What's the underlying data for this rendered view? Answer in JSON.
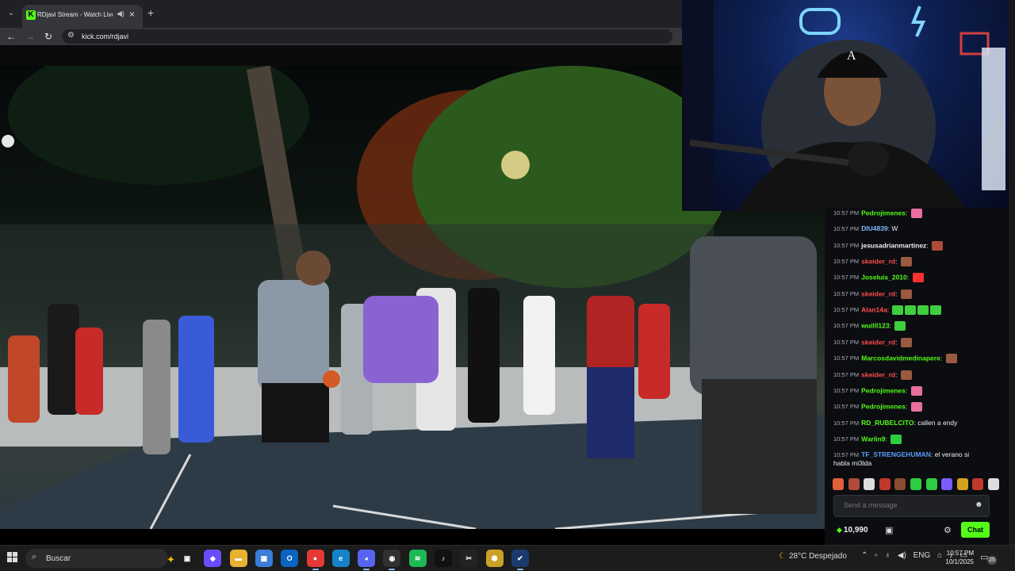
{
  "browser": {
    "tab": {
      "title": "RDjavi Stream - Watch Live",
      "favicon": "K"
    },
    "url": "kick.com/rdjavi"
  },
  "chat": {
    "messages": [
      {
        "time": "10:57 PM",
        "user": "Pedrojimenes",
        "color": "#53fc18",
        "text": "",
        "emotes": [
          "#e86fa0"
        ]
      },
      {
        "time": "10:57 PM",
        "user": "DIU4839",
        "color": "#7fb5ff",
        "text": "W",
        "emotes": []
      },
      {
        "time": "10:57 PM",
        "user": "jesusadrianmartinez",
        "color": "#efeff1",
        "text": "",
        "emotes": [
          "#b04a3a"
        ]
      },
      {
        "time": "10:57 PM",
        "user": "skeider_rd",
        "color": "#ff4d4d",
        "text": "",
        "emotes": [
          "#9a5a40"
        ]
      },
      {
        "time": "10:57 PM",
        "user": "Joseluis_2010",
        "color": "#53fc18",
        "text": "",
        "emotes": [
          "#ff3030"
        ]
      },
      {
        "time": "10:57 PM",
        "user": "skeider_rd",
        "color": "#ff4d4d",
        "text": "",
        "emotes": [
          "#9a5a40"
        ]
      },
      {
        "time": "10:57 PM",
        "user": "Alan14a",
        "color": "#ff4d4d",
        "text": "",
        "emotes": [
          "#3ecf3e",
          "#3ecf3e",
          "#3ecf3e",
          "#3ecf3e"
        ]
      },
      {
        "time": "10:57 PM",
        "user": "wuilll123",
        "color": "#53fc18",
        "text": "",
        "emotes": [
          "#3ecf3e"
        ]
      },
      {
        "time": "10:57 PM",
        "user": "skeider_rd",
        "color": "#ff4d4d",
        "text": "",
        "emotes": [
          "#9a5a40"
        ]
      },
      {
        "time": "10:57 PM",
        "user": "Marcosdavidmedinapere",
        "color": "#53fc18",
        "text": "",
        "emotes": [
          "#9a5a40"
        ]
      },
      {
        "time": "10:57 PM",
        "user": "skeider_rd",
        "color": "#ff4d4d",
        "text": "",
        "emotes": [
          "#9a5a40"
        ]
      },
      {
        "time": "10:57 PM",
        "user": "Pedrojimenes",
        "color": "#53fc18",
        "text": "",
        "emotes": [
          "#e86fa0"
        ]
      },
      {
        "time": "10:57 PM",
        "user": "Pedrojimenes",
        "color": "#53fc18",
        "text": "",
        "emotes": [
          "#e86fa0"
        ]
      },
      {
        "time": "10:57 PM",
        "user": "RD_RUBELCITO",
        "color": "#53fc18",
        "text": "callen a endy",
        "emotes": []
      },
      {
        "time": "10:57 PM",
        "user": "Warlin9",
        "color": "#53fc18",
        "text": "",
        "emotes": [
          "#2ecc40"
        ]
      },
      {
        "time": "10:57 PM",
        "user": "TF_STRENGEHUMAN",
        "color": "#5a9bff",
        "text": "el verano si",
        "text2": "habla mi3lda",
        "emotes": []
      }
    ],
    "input_placeholder": "Send a message",
    "points": "10,990",
    "send_label": "Chat",
    "emote_bar_colors": [
      "#e0603a",
      "#b04a3a",
      "#ddd",
      "#c0392b",
      "#8b4c2f",
      "#2ecc40",
      "#2ecc40",
      "#7a5cff",
      "#d4a020",
      "#c0392b",
      "#ddd"
    ]
  },
  "taskbar": {
    "search_label": "Buscar",
    "weather": "28°C  Despejado",
    "language": "ENG",
    "time": "10:57 PM",
    "date": "10/1/2025",
    "notif_count": "25",
    "apps": [
      {
        "name": "task-view",
        "glyph": "▣",
        "bg": "#1c1c1c",
        "active": false
      },
      {
        "name": "copilot",
        "glyph": "◆",
        "bg": "#6b4cff",
        "active": false
      },
      {
        "name": "file-explorer",
        "glyph": "▬",
        "bg": "#e8b130",
        "active": false
      },
      {
        "name": "ms-store",
        "glyph": "▦",
        "bg": "#3b7dd8",
        "active": false
      },
      {
        "name": "outlook",
        "glyph": "O",
        "bg": "#0a64c0",
        "active": false
      },
      {
        "name": "chrome",
        "glyph": "●",
        "bg": "#e53935",
        "active": true
      },
      {
        "name": "edge",
        "glyph": "e",
        "bg": "#1583c9",
        "active": false
      },
      {
        "name": "discord",
        "glyph": "◕",
        "bg": "#5865f2",
        "active": true
      },
      {
        "name": "obs",
        "glyph": "◉",
        "bg": "#303030",
        "active": true
      },
      {
        "name": "spotify",
        "glyph": "≋",
        "bg": "#1db954",
        "active": false
      },
      {
        "name": "tiktok",
        "glyph": "♪",
        "bg": "#111",
        "active": false
      },
      {
        "name": "capcut",
        "glyph": "✂",
        "bg": "#222",
        "active": false
      },
      {
        "name": "shield-app",
        "glyph": "⬢",
        "bg": "#c9a227",
        "active": false
      },
      {
        "name": "steam",
        "glyph": "✔",
        "bg": "#1b3b6f",
        "active": true
      }
    ]
  }
}
